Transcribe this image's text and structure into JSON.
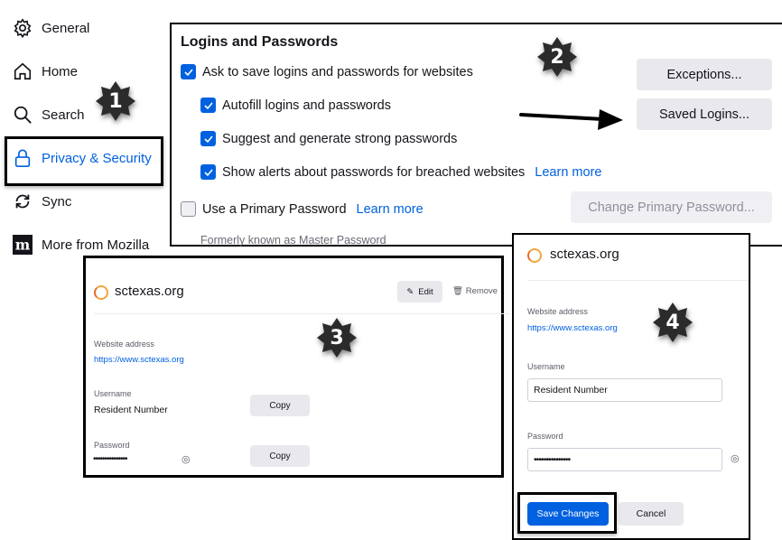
{
  "sidebar": {
    "items": [
      {
        "label": "General",
        "icon": "gear-icon"
      },
      {
        "label": "Home",
        "icon": "home-icon"
      },
      {
        "label": "Search",
        "icon": "search-icon"
      },
      {
        "label": "Privacy & Security",
        "icon": "lock-icon",
        "selected": true
      },
      {
        "label": "Sync",
        "icon": "sync-icon"
      },
      {
        "label": "More from Mozilla",
        "icon": "mozilla-icon"
      }
    ]
  },
  "logins": {
    "title": "Logins and Passwords",
    "options": [
      {
        "label": "Ask to save logins and passwords for websites",
        "checked": true
      },
      {
        "label": "Autofill logins and passwords",
        "checked": true
      },
      {
        "label": "Suggest and generate strong passwords",
        "checked": true
      },
      {
        "label": "Show alerts about passwords for breached websites",
        "checked": true,
        "link": "Learn more"
      },
      {
        "label": "Use a Primary Password",
        "checked": false,
        "link": "Learn more"
      }
    ],
    "note": "Formerly known as Master Password",
    "exceptions_button": "Exceptions...",
    "saved_logins_button": "Saved Logins...",
    "change_primary_button": "Change Primary Password..."
  },
  "view": {
    "site": "sctexas.org",
    "edit": "Edit",
    "remove": "Remove",
    "website_label": "Website address",
    "website": "https://www.sctexas.org",
    "username_label": "Username",
    "username": "Resident Number",
    "password_label": "Password",
    "password": "•••••••••••••••",
    "copy": "Copy"
  },
  "edit": {
    "site": "sctexas.org",
    "website_label": "Website address",
    "website": "https://www.sctexas.org",
    "username_label": "Username",
    "username": "Resident Number",
    "password_label": "Password",
    "password": "•••••••••••••••",
    "save": "Save Changes",
    "cancel": "Cancel"
  },
  "steps": [
    "1",
    "2",
    "3",
    "4"
  ],
  "colors": {
    "accent": "#0061e0",
    "badge": "#2b2b2b"
  }
}
